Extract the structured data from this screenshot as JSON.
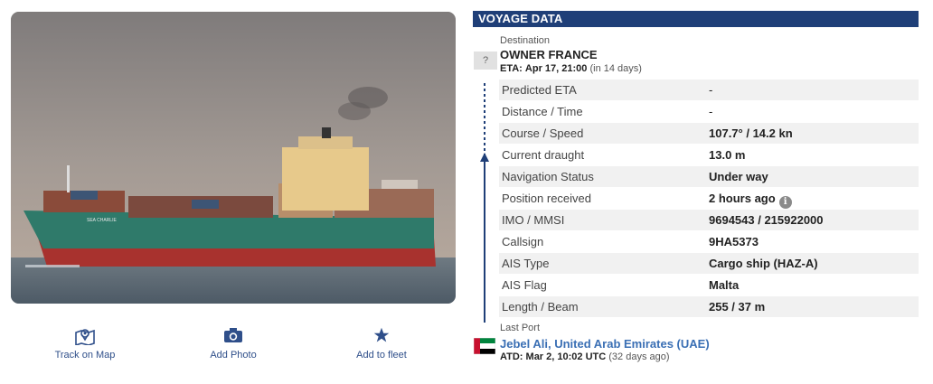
{
  "photo": {
    "ship_name_on_hull": "SEA CHARLIE"
  },
  "actions": {
    "track_on_map": "Track on Map",
    "add_photo": "Add Photo",
    "add_to_fleet": "Add to fleet"
  },
  "voyage": {
    "header": "VOYAGE DATA",
    "destination_label": "Destination",
    "destination_badge": "?",
    "destination": "OWNER FRANCE",
    "eta_label": "ETA:",
    "eta": "Apr 17, 21:00",
    "eta_relative": "(in 14 days)",
    "rows": [
      {
        "label": "Predicted ETA",
        "value": "-"
      },
      {
        "label": "Distance / Time",
        "value": "-"
      },
      {
        "label": "Course / Speed",
        "value": "107.7° / 14.2 kn"
      },
      {
        "label": "Current draught",
        "value": "13.0 m"
      },
      {
        "label": "Navigation Status",
        "value": "Under way"
      },
      {
        "label": "Position received",
        "value": "2 hours ago"
      },
      {
        "label": "IMO / MMSI",
        "value": "9694543 / 215922000"
      },
      {
        "label": "Callsign",
        "value": "9HA5373"
      },
      {
        "label": "AIS Type",
        "value": "Cargo ship (HAZ-A)"
      },
      {
        "label": "AIS Flag",
        "value": "Malta"
      },
      {
        "label": "Length / Beam",
        "value": "255 / 37 m"
      }
    ],
    "last_port_label": "Last Port",
    "last_port": "Jebel Ali, United Arab Emirates (UAE)",
    "atd_label": "ATD:",
    "atd": "Mar 2, 10:02 UTC",
    "atd_relative": "(32 days ago)"
  },
  "colors": {
    "header_bg": "#1f3f78",
    "link": "#3a6fb4",
    "action": "#2f4f8a",
    "hull_green": "#2f7a6a",
    "hull_red": "#a8322e"
  },
  "icons": [
    "map-pin-icon",
    "camera-icon",
    "star-icon",
    "info-icon",
    "uae-flag-icon"
  ]
}
